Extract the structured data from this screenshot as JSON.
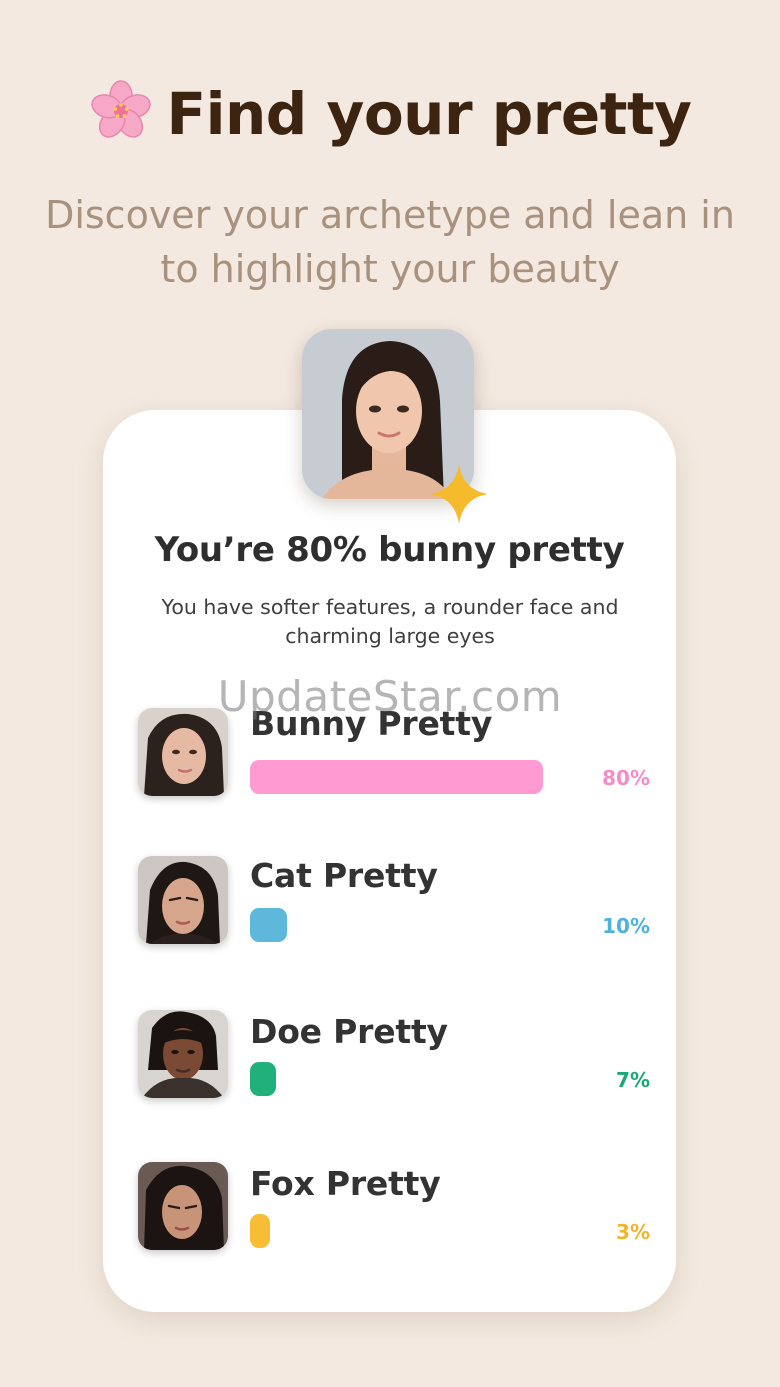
{
  "header": {
    "title": "Find your pretty",
    "subtitle": "Discover your archetype and lean in to highlight your beauty"
  },
  "result": {
    "title": "You’re 80% bunny pretty",
    "description": "You have softer features, a rounder face and charming large eyes"
  },
  "watermark": "UpdateStar.com",
  "archetypes": [
    {
      "label": "Bunny Pretty",
      "percent": 80,
      "percent_label": "80%",
      "color": "#ff9ad2",
      "text_color": "#f58cc8"
    },
    {
      "label": "Cat Pretty",
      "percent": 10,
      "percent_label": "10%",
      "color": "#5db8dc",
      "text_color": "#4fb2dc"
    },
    {
      "label": "Doe Pretty",
      "percent": 7,
      "percent_label": "7%",
      "color": "#20b07a",
      "text_color": "#1aa874"
    },
    {
      "label": "Fox Pretty",
      "percent": 3,
      "percent_label": "3%",
      "color": "#f7be35",
      "text_color": "#f0b52a"
    }
  ],
  "colors": {
    "background": "#f3e9e0",
    "title": "#3d2410",
    "subtitle": "#a8927d",
    "card": "#ffffff",
    "sparkle": "#f6bb2c"
  },
  "icons": {
    "title_icon": "cherry-blossom-icon",
    "photo_badge": "sparkle-icon"
  }
}
